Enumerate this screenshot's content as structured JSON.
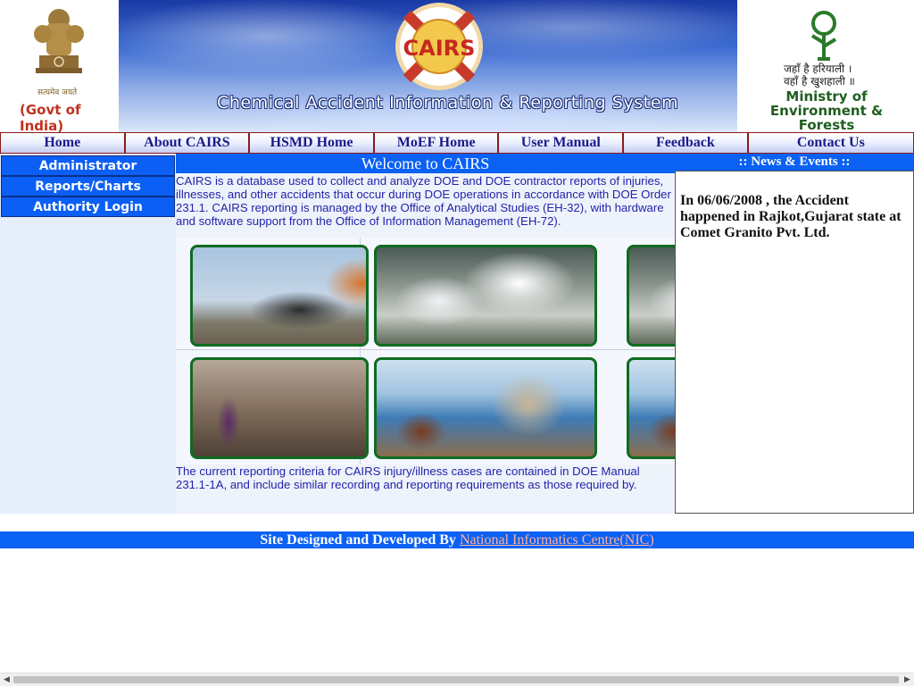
{
  "header": {
    "emblem_caption": "सत्यमेव जयते",
    "govt_label": "(Govt of India)",
    "logo_text": "CAIRS",
    "system_title": "Chemical Accident Information & Reporting System",
    "moef_hindi_line1": "जहाँ है हरियाली ।",
    "moef_hindi_line2": "वहाँ है खुशहाली ॥",
    "moef_name": "Ministry of Environment & Forests"
  },
  "nav": {
    "items": [
      {
        "label": "Home"
      },
      {
        "label": "About CAIRS"
      },
      {
        "label": "HSMD Home"
      },
      {
        "label": "MoEF Home"
      },
      {
        "label": "User Manual"
      },
      {
        "label": "Feedback"
      },
      {
        "label": "Contact Us"
      }
    ]
  },
  "sidebar": {
    "items": [
      {
        "label": "Administrator"
      },
      {
        "label": "Reports/Charts"
      },
      {
        "label": "Authority Login"
      }
    ]
  },
  "main": {
    "welcome": "Welcome to CAIRS",
    "intro": "CAIRS is a database used to collect and analyze DOE and DOE contractor reports of injuries, illnesses, and other accidents that occur during DOE operations in accordance with DOE Order 231.1. CAIRS reporting is managed by the Office of Analytical Studies (EH-32), with hardware and software support from the Office of Information Management (EH-72).",
    "outro": "The current reporting criteria for CAIRS injury/illness cases are contained in DOE Manual 231.1-1A, and include similar recording and reporting requirements as those required by."
  },
  "news": {
    "header": ":: News & Events ::",
    "item": "In 06/06/2008 , the Accident happened in Rajkot,Gujarat state at Comet Granito Pvt. Ltd."
  },
  "footer": {
    "prefix": "Site Designed and Developed By ",
    "link_text": "National Informatics Centre(NIC)"
  },
  "colors": {
    "nav_border": "#8b1a1a",
    "accent_blue": "#0b61f4",
    "nav_text": "#1a1a8a",
    "body_text": "#2222aa"
  }
}
